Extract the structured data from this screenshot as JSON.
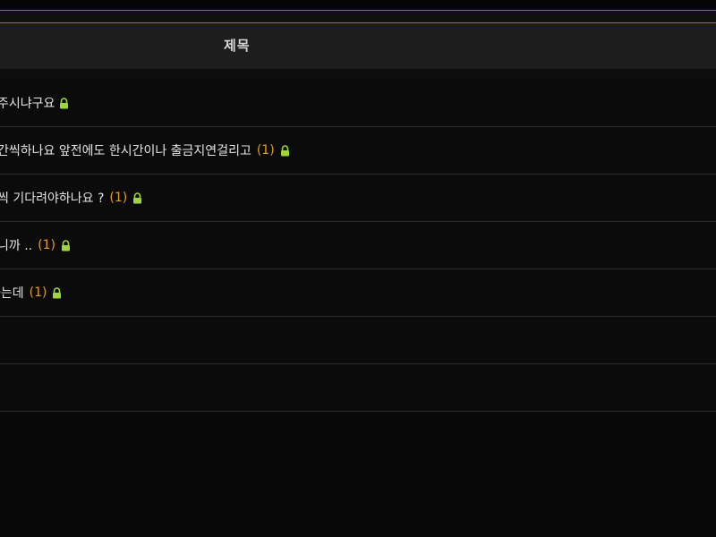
{
  "table": {
    "header_title": "제목",
    "rows": [
      {
        "title": "주시냐구요",
        "count": "",
        "locked": true
      },
      {
        "title": "간씩하나요 앞전에도 한시간이나 출금지연걸리고",
        "count": "(1)",
        "locked": true
      },
      {
        "title": "씩 기다려야하나요 ?",
        "count": "(1)",
        "locked": true
      },
      {
        "title": "니까 ..",
        "count": "(1)",
        "locked": true
      },
      {
        "title": "하는데",
        "count": "(1)",
        "locked": true
      },
      {
        "title": "",
        "count": "",
        "locked": false
      },
      {
        "title": "",
        "count": "",
        "locked": false
      }
    ]
  },
  "colors": {
    "accent_gold": "#8a7443",
    "count_orange": "#e49c1f",
    "lock_green": "#9ed53a"
  },
  "icons": {
    "lock": "lock-icon"
  }
}
